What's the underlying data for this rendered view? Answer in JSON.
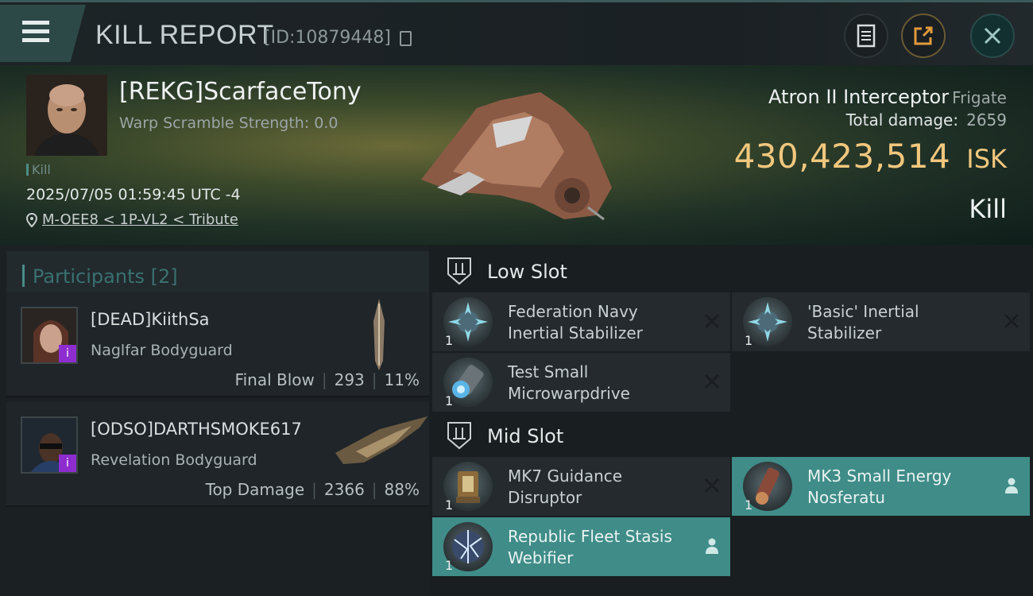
{
  "header": {
    "title": "KILL REPORT",
    "report_id": "[ID:10879448]"
  },
  "victim": {
    "name": "[REKG]ScarfaceTony",
    "warp_scramble": "Warp Scramble Strength: 0.0",
    "kill_tag": "Kill",
    "timestamp": "2025/07/05 01:59:45 UTC -4",
    "location": "M-OEE8 < 1P-VL2 < Tribute",
    "ship_name": "Atron II Interceptor",
    "ship_class": "Frigate",
    "damage_label": "Total damage:",
    "damage_value": "2659",
    "isk_value": "430,423,514",
    "isk_unit": "ISK",
    "result": "Kill"
  },
  "participants": {
    "title": "Participants [2]",
    "list": [
      {
        "name": "[DEAD]KiithSa",
        "ship": "Naglfar Bodyguard",
        "role": "Final Blow",
        "damage": "293",
        "percent": "11%"
      },
      {
        "name": "[ODSO]DARTHSMOKE617",
        "ship": "Revelation Bodyguard",
        "role": "Top Damage",
        "damage": "2366",
        "percent": "88%"
      }
    ]
  },
  "fitting": {
    "low_slot": {
      "title": "Low Slot",
      "modules": [
        {
          "name": "Federation Navy Inertial Stabilizer",
          "qty": "1",
          "status": "destroyed"
        },
        {
          "name": "'Basic' Inertial Stabilizer",
          "qty": "1",
          "status": "destroyed"
        },
        {
          "name": "Test Small Microwarpdrive",
          "qty": "1",
          "status": "destroyed"
        }
      ]
    },
    "mid_slot": {
      "title": "Mid Slot",
      "modules": [
        {
          "name": "MK7 Guidance Disruptor",
          "qty": "1",
          "status": "destroyed"
        },
        {
          "name": "MK3 Small Energy Nosferatu",
          "qty": "1",
          "status": "dropped"
        },
        {
          "name": "Republic Fleet Stasis Webifier",
          "qty": "1",
          "status": "dropped"
        }
      ]
    }
  },
  "colors": {
    "isk": "#f1c77e",
    "highlight": "#3f8c88",
    "badge": "#8d2dd0",
    "accent": "#4a8c88"
  }
}
